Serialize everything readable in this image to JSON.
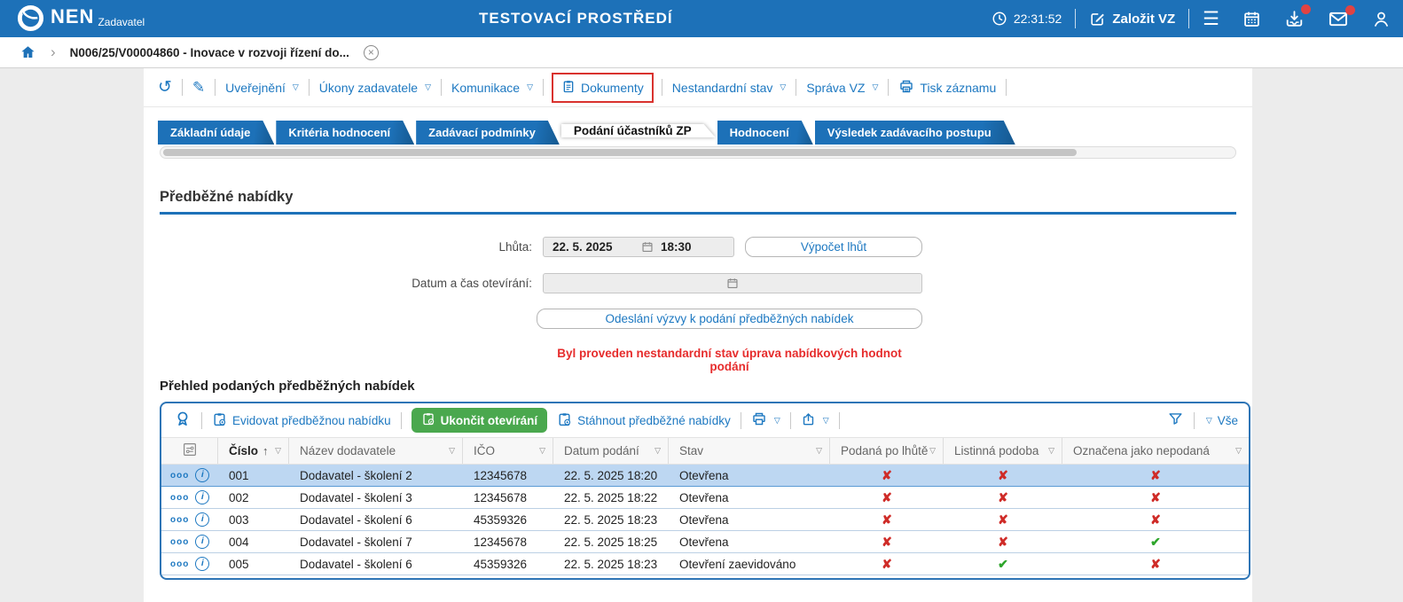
{
  "colors": {
    "brand_blue": "#1d71b8",
    "link_blue": "#1d78c1",
    "green": "#4aa84e",
    "mark_red": "#cf2b27",
    "mark_green": "#2ea52b",
    "warning_red": "#e62c2c",
    "selected_row": "#bdd7f2",
    "highlight_box_red": "#d9322e"
  },
  "topbar": {
    "brand": "NEN",
    "brand_sub": "Zadavatel",
    "title": "TESTOVACÍ PROSTŘEDÍ",
    "time": "22:31:52",
    "create_button": "Založit VZ"
  },
  "breadcrumb": {
    "item": "N006/25/V00004860 - Inovace v rozvoji řízení do..."
  },
  "actions": {
    "uverejneni": "Uveřejnění",
    "ukony": "Úkony zadavatele",
    "komunikace": "Komunikace",
    "dokumenty": "Dokumenty",
    "nestandardni": "Nestandardní stav",
    "sprava": "Správa VZ",
    "tisk": "Tisk záznamu"
  },
  "tabs": [
    {
      "label": "Základní údaje",
      "active": false
    },
    {
      "label": "Kritéria hodnocení",
      "active": false
    },
    {
      "label": "Zadávací podmínky",
      "active": false
    },
    {
      "label": "Podání účastníků ZP",
      "active": true
    },
    {
      "label": "Hodnocení",
      "active": false
    },
    {
      "label": "Výsledek zadávacího postupu",
      "active": false
    }
  ],
  "prelim": {
    "title": "Předběžné nabídky",
    "deadline_label": "Lhůta:",
    "deadline_date": "22. 5. 2025",
    "deadline_time": "18:30",
    "calc_button": "Výpočet lhůt",
    "opening_label": "Datum a čas otevírání:",
    "opening_value": "",
    "send_button": "Odeslání výzvy k podání předběžných nabídek",
    "warning": "Byl proveden nestandardní stav úprava nabídkových hodnot podání"
  },
  "overview": {
    "title": "Přehled podaných předběžných nabídek",
    "toolbar": {
      "evidovat": "Evidovat předběžnou nabídku",
      "ukoncit": "Ukončit otevírání",
      "stahnout": "Stáhnout předběžné nabídky",
      "vse": "Vše"
    },
    "columns": {
      "num": "Číslo",
      "supplier": "Název dodavatele",
      "ico": "IČO",
      "submitted": "Datum podání",
      "status": "Stav",
      "late": "Podaná po lhůtě",
      "paper": "Listinná podoba",
      "not_submitted": "Označena jako nepodaná"
    },
    "rows": [
      {
        "num": "001",
        "supplier": "Dodavatel - školení 2",
        "ico": "12345678",
        "submitted": "22. 5. 2025 18:20",
        "status": "Otevřena",
        "late": {
          "glyph": "✘",
          "state": "no"
        },
        "paper": {
          "glyph": "✘",
          "state": "no"
        },
        "not_submitted": {
          "glyph": "✘",
          "state": "no"
        }
      },
      {
        "num": "002",
        "supplier": "Dodavatel - školení 3",
        "ico": "12345678",
        "submitted": "22. 5. 2025 18:22",
        "status": "Otevřena",
        "late": {
          "glyph": "✘",
          "state": "no"
        },
        "paper": {
          "glyph": "✘",
          "state": "no"
        },
        "not_submitted": {
          "glyph": "✘",
          "state": "no"
        }
      },
      {
        "num": "003",
        "supplier": "Dodavatel - školení 6",
        "ico": "45359326",
        "submitted": "22. 5. 2025 18:23",
        "status": "Otevřena",
        "late": {
          "glyph": "✘",
          "state": "no"
        },
        "paper": {
          "glyph": "✘",
          "state": "no"
        },
        "not_submitted": {
          "glyph": "✘",
          "state": "no"
        }
      },
      {
        "num": "004",
        "supplier": "Dodavatel - školení 7",
        "ico": "12345678",
        "submitted": "22. 5. 2025 18:25",
        "status": "Otevřena",
        "late": {
          "glyph": "✘",
          "state": "no"
        },
        "paper": {
          "glyph": "✘",
          "state": "no"
        },
        "not_submitted": {
          "glyph": "✔",
          "state": "yes"
        }
      },
      {
        "num": "005",
        "supplier": "Dodavatel - školení 6",
        "ico": "45359326",
        "submitted": "22. 5. 2025 18:23",
        "status": "Otevření zaevidováno",
        "late": {
          "glyph": "✘",
          "state": "no"
        },
        "paper": {
          "glyph": "✔",
          "state": "yes"
        },
        "not_submitted": {
          "glyph": "✘",
          "state": "no"
        }
      }
    ]
  },
  "icons": {
    "dropdown": "▽",
    "sort_asc": "↑",
    "chevron": "›",
    "close": "×",
    "hamburger": "☰",
    "history": "↺",
    "pencil": "✎",
    "dots": "ooo",
    "info": "i"
  }
}
